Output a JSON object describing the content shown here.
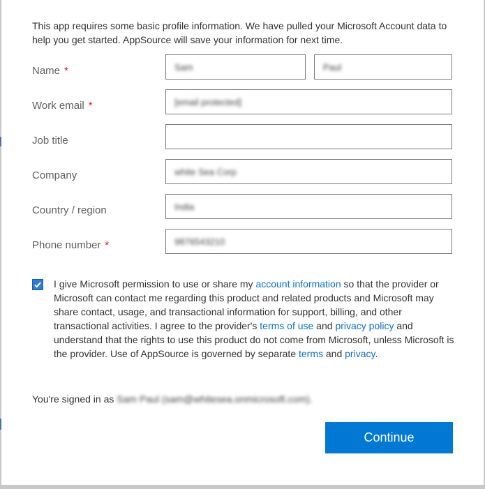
{
  "intro_text": "This app requires some basic profile information. We have pulled your Microsoft Account data to help you get started. AppSource will save your information for next time.",
  "form": {
    "name_label": "Name",
    "first_name_value": "Sam",
    "last_name_value": "Paul",
    "work_email_label": "Work email",
    "work_email_value": "[email protected]",
    "job_title_label": "Job title",
    "job_title_value": "",
    "company_label": "Company",
    "company_value": "white Sea Corp",
    "country_label": "Country / region",
    "country_value": "India",
    "phone_label": "Phone number",
    "phone_value": "9876543210",
    "required_marker": "*"
  },
  "consent": {
    "checked": true,
    "text_1": "I give Microsoft permission to use or share my ",
    "link_account_info": "account information",
    "text_2": " so that the provider or Microsoft can contact me regarding this product and related products and Microsoft may share contact, usage, and transactional information for support, billing, and other transactional activities. I agree to the provider's ",
    "link_terms_of_use": "terms of use",
    "text_3": " and ",
    "link_privacy_policy": "privacy policy",
    "text_4": " and understand that the rights to use this product do not come from Microsoft, unless Microsoft is the provider. Use of AppSource is governed by separate ",
    "link_terms": "terms",
    "text_5": " and ",
    "link_privacy": "privacy",
    "text_6": "."
  },
  "signed_in": {
    "prefix": "You're signed in as ",
    "account": "Sam Paul (sam@whitesea.onmicrosoft.com)."
  },
  "continue_label": "Continue",
  "colors": {
    "accent": "#0078d4",
    "link": "#0b6fc9",
    "required": "#e8112d"
  }
}
